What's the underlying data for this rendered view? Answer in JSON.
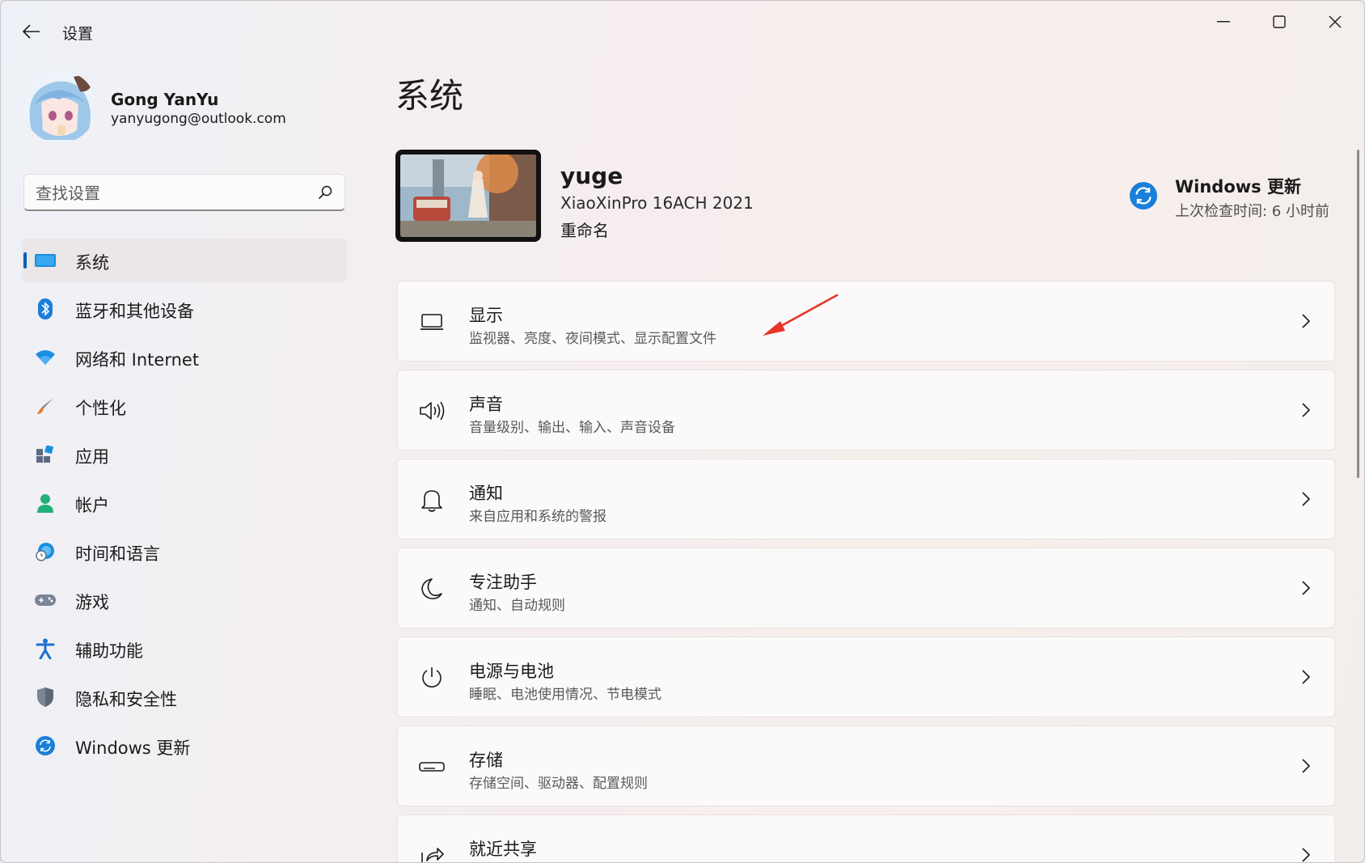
{
  "app": {
    "title": "设置"
  },
  "profile": {
    "name": "Gong YanYu",
    "email": "yanyugong@outlook.com"
  },
  "search": {
    "placeholder": "查找设置"
  },
  "sidebar": {
    "items": [
      {
        "label": "系统",
        "icon": "monitor-icon"
      },
      {
        "label": "蓝牙和其他设备",
        "icon": "bluetooth-icon"
      },
      {
        "label": "网络和 Internet",
        "icon": "wifi-icon"
      },
      {
        "label": "个性化",
        "icon": "brush-icon"
      },
      {
        "label": "应用",
        "icon": "apps-icon"
      },
      {
        "label": "帐户",
        "icon": "account-icon"
      },
      {
        "label": "时间和语言",
        "icon": "globe-clock-icon"
      },
      {
        "label": "游戏",
        "icon": "gamepad-icon"
      },
      {
        "label": "辅助功能",
        "icon": "accessibility-icon"
      },
      {
        "label": "隐私和安全性",
        "icon": "shield-icon"
      },
      {
        "label": "Windows 更新",
        "icon": "update-icon"
      }
    ]
  },
  "main": {
    "title": "系统",
    "device": {
      "name": "yuge",
      "model": "XiaoXinPro 16ACH 2021",
      "rename": "重命名"
    },
    "windows_update": {
      "title": "Windows 更新",
      "subtitle": "上次检查时间: 6 小时前"
    },
    "cards": [
      {
        "title": "显示",
        "subtitle": "监视器、亮度、夜间模式、显示配置文件",
        "icon": "display-icon"
      },
      {
        "title": "声音",
        "subtitle": "音量级别、输出、输入、声音设备",
        "icon": "speaker-icon"
      },
      {
        "title": "通知",
        "subtitle": "来自应用和系统的警报",
        "icon": "bell-icon"
      },
      {
        "title": "专注助手",
        "subtitle": "通知、自动规则",
        "icon": "moon-icon"
      },
      {
        "title": "电源与电池",
        "subtitle": "睡眠、电池使用情况、节电模式",
        "icon": "power-icon"
      },
      {
        "title": "存储",
        "subtitle": "存储空间、驱动器、配置规则",
        "icon": "storage-icon"
      },
      {
        "title": "就近共享",
        "subtitle": "",
        "icon": "share-icon"
      }
    ]
  },
  "colors": {
    "accent": "#005fb8",
    "annotation_arrow": "#e8342a"
  }
}
